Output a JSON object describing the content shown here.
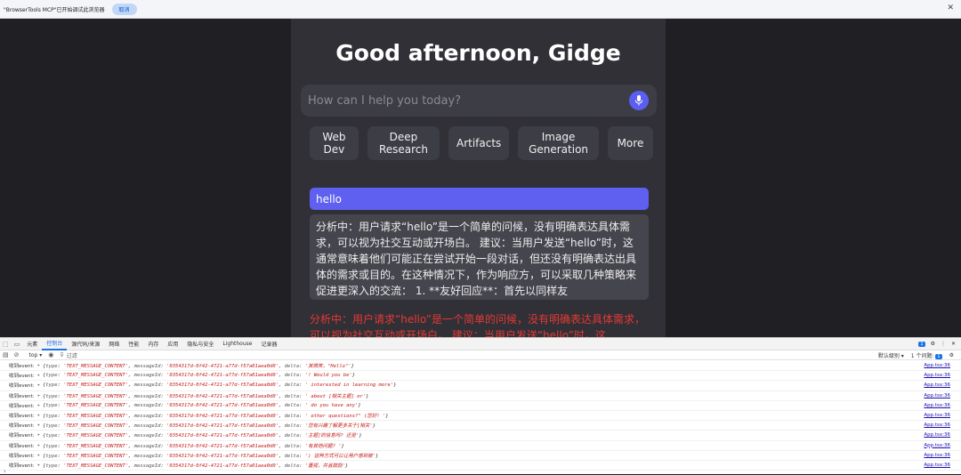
{
  "infobar": {
    "message": "\"BrowserTools MCP\"已开始调试此浏览器",
    "cancel_label": "取消",
    "close_glyph": "✕"
  },
  "main": {
    "greeting": "Good afternoon, Gidge",
    "search": {
      "placeholder": "How can I help you today?",
      "mic_icon": "microphone-icon"
    },
    "chips": [
      {
        "label": "Web\nDev"
      },
      {
        "label": "Deep\nResearch"
      },
      {
        "label": "Artifacts"
      },
      {
        "label": "Image\nGeneration"
      },
      {
        "label": "More"
      }
    ],
    "user_message": "hello",
    "ai_message": "分析中：用户请求“hello”是一个简单的问候，没有明确表达具体需求，可以视为社交互动或开场白。 建议：当用户发送“hello”时，这通常意味着他们可能正在尝试开始一段对话，但还没有明确表达出具体的需求或目的。在这种情况下，作为响应方，可以采取几种策略来促进更深入的交流： 1. **友好回应**：首先以同样友",
    "red_text": "分析中：用户请求“hello”是一个简单的问候，没有明确表达具体需求，可以视为社交互动或开场白。 建议：当用户发送“hello”时，这"
  },
  "devtools": {
    "tabs": [
      "元素",
      "控制台",
      "源代码/来源",
      "网络",
      "性能",
      "内存",
      "应用",
      "隐私与安全",
      "Lighthouse",
      "记录器"
    ],
    "active_tab": "控制台",
    "issues_count": "1",
    "context": "top ▾",
    "filter_placeholder": "过滤",
    "level_label": "默认级别 ▾",
    "issues_label": "1 个问题:",
    "issues_badge": "1",
    "prompt": "›",
    "logs": [
      {
        "label": "收到event:",
        "type": "'TEXT_MESSAGE_CONTENT'",
        "id": "'0354317d-0f42-4721-a77d-f57a01aea0d0'",
        "delta": "'其微笑，\"Hello\"'",
        "source": "App.tsx:36"
      },
      {
        "label": "收到event:",
        "type": "'TEXT_MESSAGE_CONTENT'",
        "id": "'0354317d-0f42-4721-a77d-f57a01aea0d0'",
        "delta": "'! Would you be'",
        "source": "App.tsx:36"
      },
      {
        "label": "收到event:",
        "type": "'TEXT_MESSAGE_CONTENT'",
        "id": "'0354317d-0f42-4721-a77d-f57a01aea0d0'",
        "delta": "' interested in learning more'",
        "source": "App.tsx:36"
      },
      {
        "label": "收到event:",
        "type": "'TEXT_MESSAGE_CONTENT'",
        "id": "'0354317d-0f42-4721-a77d-f57a01aea0d0'",
        "delta": "' about [相关主题] or'",
        "source": "App.tsx:36"
      },
      {
        "label": "收到event:",
        "type": "'TEXT_MESSAGE_CONTENT'",
        "id": "'0354317d-0f42-4721-a77d-f57a01aea0d0'",
        "delta": "' do you have any'",
        "source": "App.tsx:36"
      },
      {
        "label": "收到event:",
        "type": "'TEXT_MESSAGE_CONTENT'",
        "id": "'0354317d-0f42-4721-a77d-f57a01aea0d0'",
        "delta": "' other questions?\" (您好! '",
        "source": "App.tsx:36"
      },
      {
        "label": "收到event:",
        "type": "'TEXT_MESSAGE_CONTENT'",
        "id": "'0354317d-0f42-4721-a77d-f57a01aea0d0'",
        "delta": "'您有兴趣了解更多关于[相关'",
        "source": "App.tsx:36"
      },
      {
        "label": "收到event:",
        "type": "'TEXT_MESSAGE_CONTENT'",
        "id": "'0354317d-0f42-4721-a77d-f57a01aea0d0'",
        "delta": "'主题]的信息吗? 还是'",
        "source": "App.tsx:36"
      },
      {
        "label": "收到event:",
        "type": "'TEXT_MESSAGE_CONTENT'",
        "id": "'0354317d-0f42-4721-a77d-f57a01aea0d0'",
        "delta": "'有其他问题? '",
        "source": "App.tsx:36"
      },
      {
        "label": "收到event:",
        "type": "'TEXT_MESSAGE_CONTENT'",
        "id": "'0354317d-0f42-4721-a77d-f57a01aea0d0'",
        "delta": "') 这种方式可以让用户感到被'",
        "source": "App.tsx:36"
      },
      {
        "label": "收到event:",
        "type": "'TEXT_MESSAGE_CONTENT'",
        "id": "'0354317d-0f42-4721-a77d-f57a01aea0d0'",
        "delta": "'重视，并且鼓励'",
        "source": "App.tsx:36"
      }
    ]
  }
}
